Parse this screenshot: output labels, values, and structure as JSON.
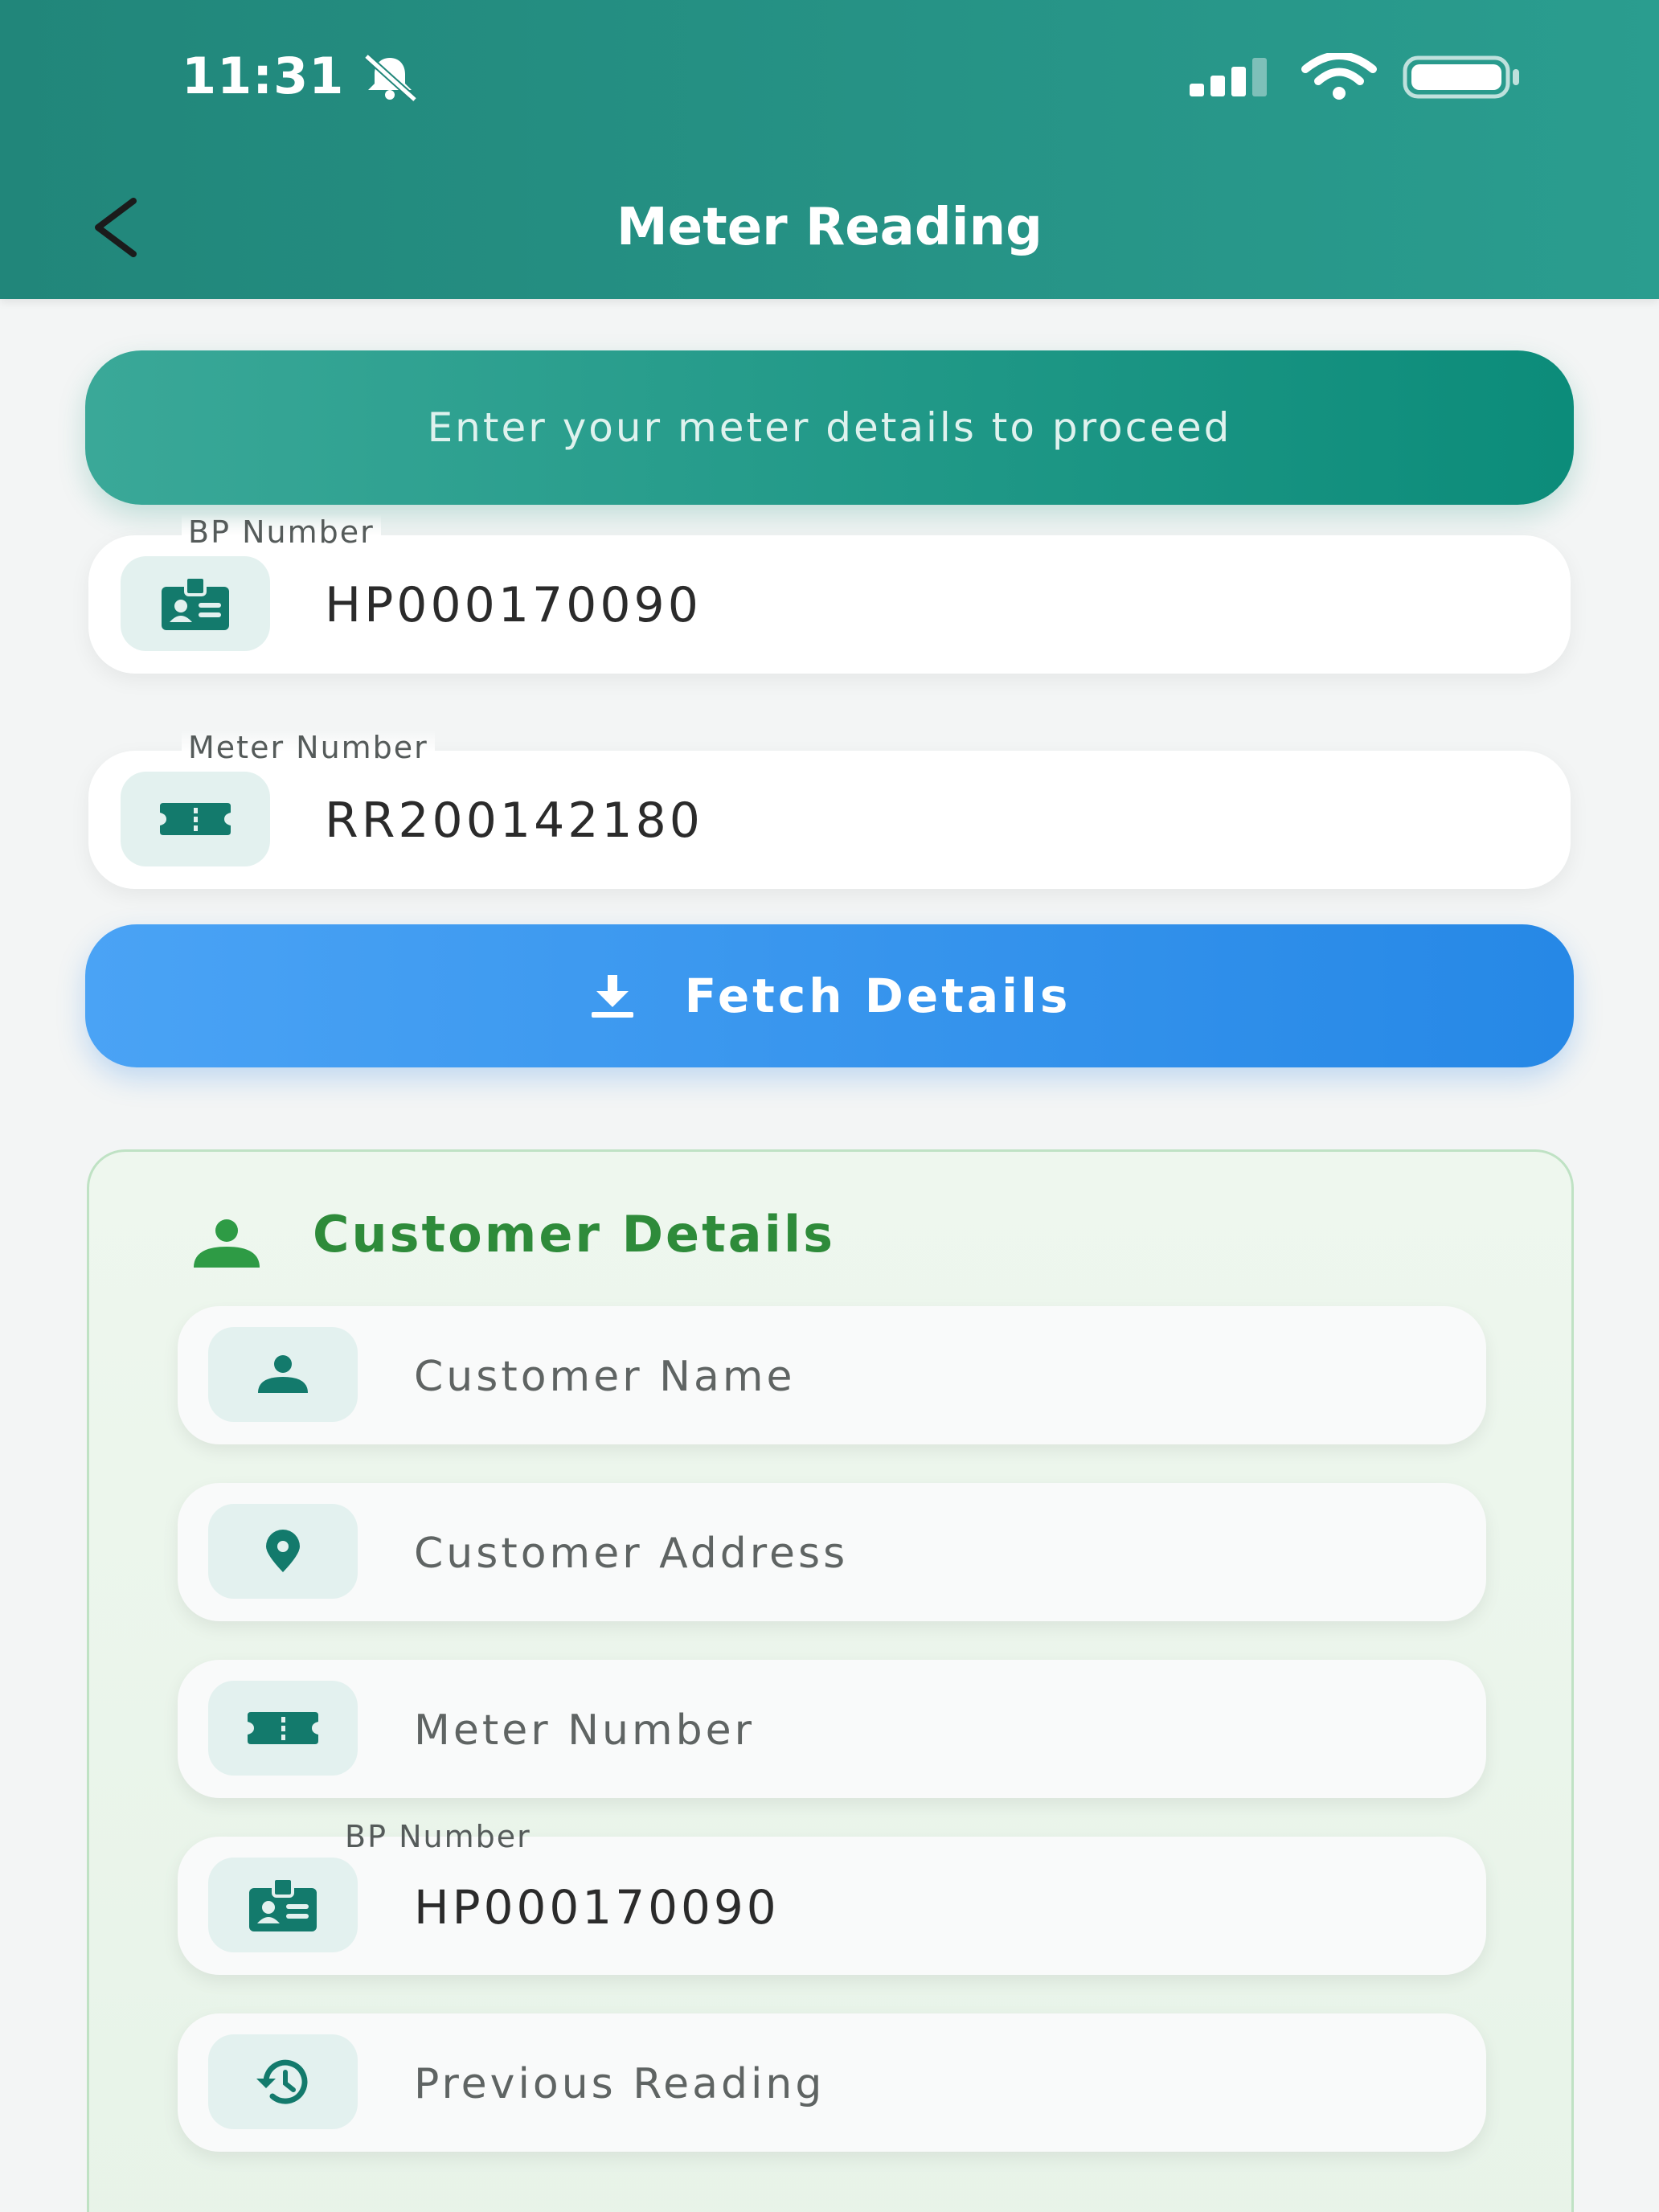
{
  "status_bar": {
    "time": "11:31"
  },
  "header": {
    "title": "Meter Reading"
  },
  "banner": {
    "text": "Enter your meter details to proceed"
  },
  "inputs": {
    "bp": {
      "label": "BP Number",
      "value": "HP000170090"
    },
    "meter": {
      "label": "Meter Number",
      "value": "RR200142180"
    }
  },
  "fetch_button": {
    "label": "Fetch Details"
  },
  "customer_details": {
    "title": "Customer Details",
    "rows": [
      {
        "placeholder": "Customer Name",
        "icon": "person-icon"
      },
      {
        "placeholder": "Customer Address",
        "icon": "location-pin-icon"
      },
      {
        "placeholder": "Meter Number",
        "icon": "meter-icon"
      },
      {
        "label": "BP Number",
        "value": "HP000170090",
        "icon": "badge-icon"
      },
      {
        "placeholder": "Previous Reading",
        "icon": "history-icon"
      }
    ]
  },
  "colors": {
    "header": "#21867a",
    "banner": "#0c8c7a",
    "fetch_button": "#2688e6",
    "card_title": "#2e8b3a",
    "icon_teal": "#137a6c"
  }
}
